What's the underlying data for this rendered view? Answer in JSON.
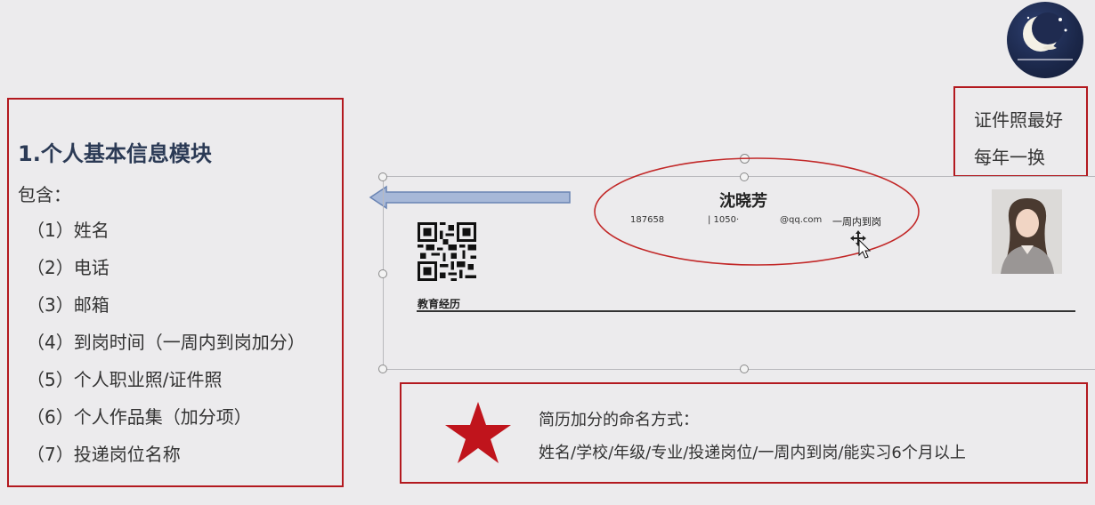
{
  "info": {
    "title": "1.个人基本信息模块",
    "subtitle": "包含：",
    "items": [
      "（1）姓名",
      "（2）电话",
      "（3）邮箱",
      "（4）到岗时间（一周内到岗加分）",
      "（5）个人职业照/证件照",
      "（6）个人作品集（加分项）",
      "（7）投递岗位名称"
    ]
  },
  "tip": {
    "line1": "证件照最好",
    "line2": "每年一换"
  },
  "resume": {
    "name": "沈晓芳",
    "phone": "187658",
    "qq": "| 1050·",
    "email": "@qq.com",
    "arrival": "一周内到岗",
    "education_heading": "教育经历"
  },
  "naming": {
    "title": "简历加分的命名方式：",
    "format": "姓名/学校/年级/专业/投递岗位/一周内到岗/能实习6个月以上"
  },
  "colors": {
    "border_red": "#b3191f",
    "star_red": "#c0141c",
    "arrow_blue": "#9fb3d6",
    "title_navy": "#2b3a55",
    "ellipse_red": "#c22828"
  },
  "icons": {
    "star": "star-icon",
    "arrow": "left-arrow-icon",
    "cursor": "move-cursor-icon",
    "qr": "qr-code-icon",
    "logo": "moon-logo-icon"
  }
}
